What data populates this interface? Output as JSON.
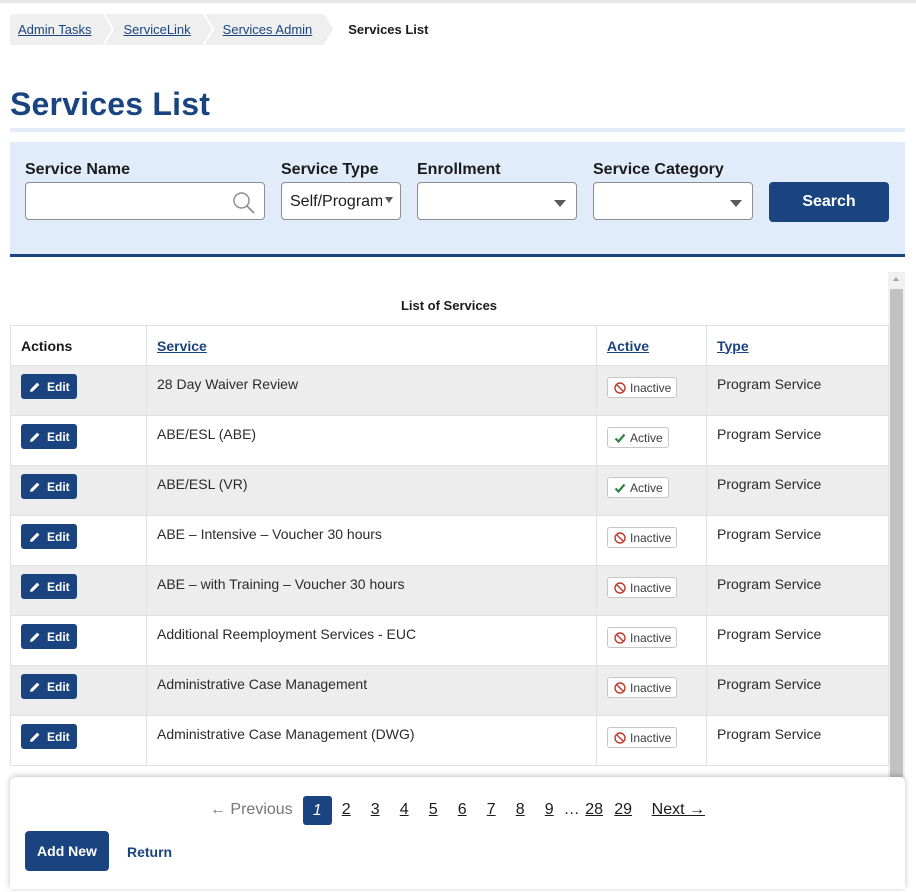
{
  "breadcrumb": [
    {
      "label": "Admin Tasks"
    },
    {
      "label": "ServiceLink"
    },
    {
      "label": "Services Admin"
    },
    {
      "label": "Services List"
    }
  ],
  "page_title": "Services List",
  "filters": {
    "service_name_label": "Service Name",
    "service_name_value": "",
    "service_type_label": "Service Type",
    "service_type_value": "Self/Program",
    "enrollment_label": "Enrollment",
    "enrollment_value": "",
    "service_category_label": "Service Category",
    "service_category_value": "",
    "search_label": "Search"
  },
  "table": {
    "caption": "List of Services",
    "headers": [
      "Actions",
      "Service",
      "Active",
      "Type"
    ],
    "edit_label": "Edit",
    "rows": [
      {
        "service": "28 Day Waiver Review",
        "active": "Inactive",
        "type": "Program Service"
      },
      {
        "service": "ABE/ESL (ABE)",
        "active": "Active",
        "type": "Program Service"
      },
      {
        "service": "ABE/ESL (VR)",
        "active": "Active",
        "type": "Program Service"
      },
      {
        "service": "ABE – Intensive – Voucher 30 hours",
        "active": "Inactive",
        "type": "Program Service"
      },
      {
        "service": "ABE – with Training – Voucher 30 hours",
        "active": "Inactive",
        "type": "Program Service"
      },
      {
        "service": "Additional Reemployment Services - EUC",
        "active": "Inactive",
        "type": "Program Service"
      },
      {
        "service": "Administrative Case Management",
        "active": "Inactive",
        "type": "Program Service"
      },
      {
        "service": "Administrative Case Management (DWG)",
        "active": "Inactive",
        "type": "Program Service"
      }
    ]
  },
  "pagination": {
    "previous_label": "← Previous",
    "pages": [
      "1",
      "2",
      "3",
      "4",
      "5",
      "6",
      "7",
      "8",
      "9"
    ],
    "ellipsis": "…",
    "last_pages": [
      "28",
      "29"
    ],
    "current_page": "1",
    "next_label": "Next →"
  },
  "buttons": {
    "add_new": "Add New",
    "return": "Return"
  },
  "colors": {
    "primary": "#1a4480",
    "filter_bg": "#e1ecfa",
    "active_icon": "#2e8540",
    "inactive_icon": "#c0392b"
  }
}
